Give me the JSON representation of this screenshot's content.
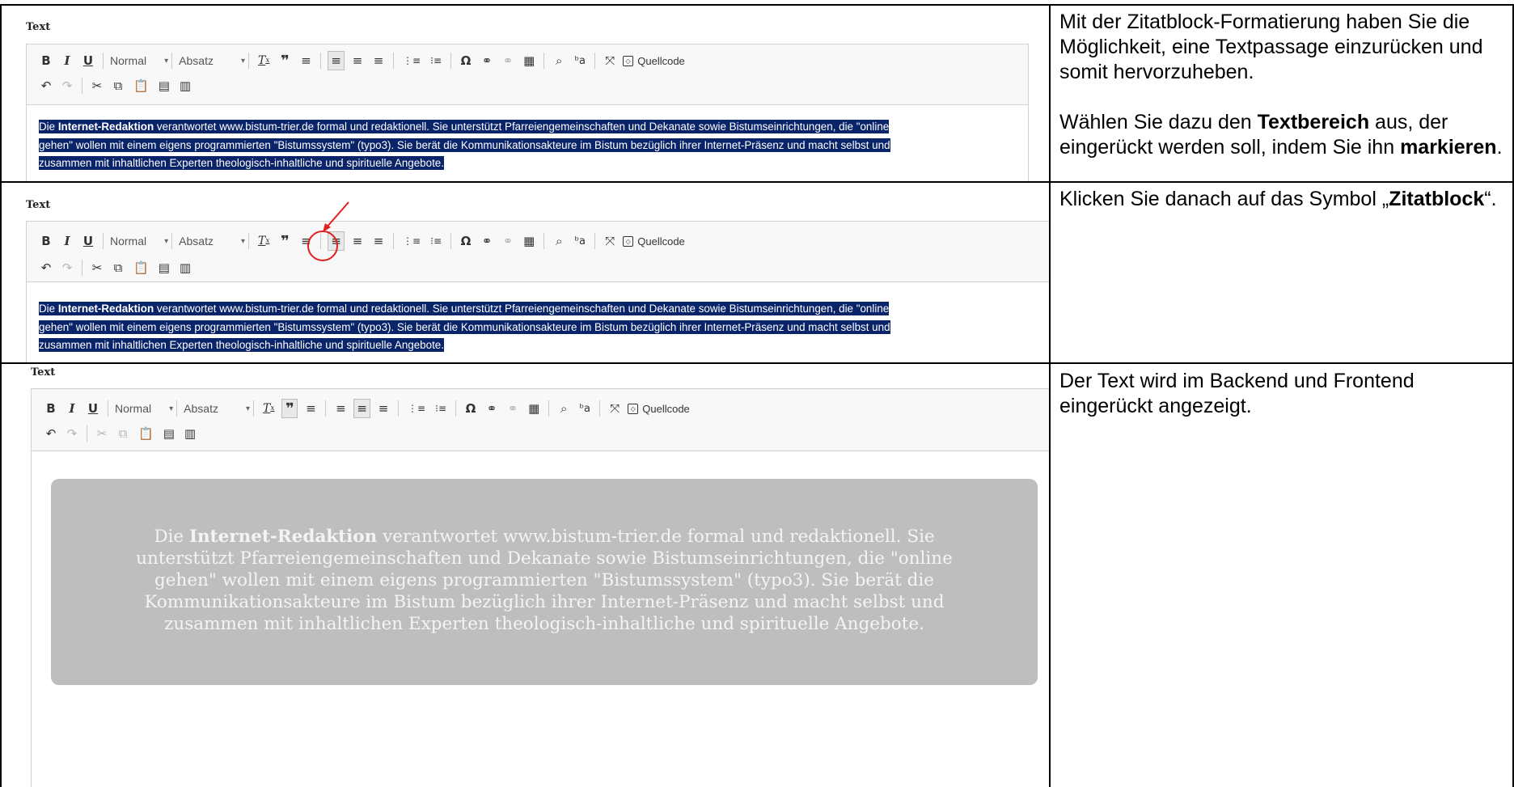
{
  "editor": {
    "label": "Text",
    "toolbar": {
      "bold": "B",
      "italic": "I",
      "underline": "U",
      "style_select": "Normal",
      "format_select": "Absatz",
      "dropdown_arrow": "▾",
      "remove_format": "Tx",
      "blockquote": "❞",
      "source_label": "Quellcode",
      "icons": [
        "bold-icon",
        "italic-icon",
        "underline-icon",
        "remove-format-icon",
        "blockquote-icon",
        "horizontal-rule-icon",
        "align-left-icon",
        "align-center-icon",
        "align-right-icon",
        "numbered-list-icon",
        "bulleted-list-icon",
        "special-char-icon",
        "link-icon",
        "unlink-icon",
        "table-icon",
        "find-icon",
        "replace-icon",
        "maximize-icon",
        "source-icon",
        "undo-icon",
        "redo-icon",
        "cut-icon",
        "copy-icon",
        "paste-icon",
        "paste-text-icon",
        "paste-word-icon"
      ]
    },
    "content_pre": "Die ",
    "content_bold": "Internet-Redaktion",
    "content_line1": " verantwortet www.bistum-trier.de formal und redaktionell. Sie unterstützt Pfarreiengemeinschaften und Dekanate sowie Bistumseinrichtungen, die \"online",
    "content_line2": "gehen\" wollen mit einem eigens programmierten \"Bistumssystem\" (typo3). Sie berät die Kommunikationsakteure im Bistum bezüglich ihrer Internet-Präsenz und macht selbst und",
    "content_line3": "zusammen mit inhaltlichen Experten theologisch-inhaltliche und spirituelle Angebote.",
    "quote_line1_rest": " verantwortet www.bistum-trier.de formal und redaktionell. Sie",
    "quote_line2": "unterstützt Pfarreiengemeinschaften und Dekanate sowie Bistumseinrichtungen, die \"online",
    "quote_line3": "gehen\" wollen mit einem eigens programmierten \"Bistumssystem\" (typo3). Sie berät die",
    "quote_line4": "Kommunikationsakteure im Bistum bezüglich ihrer Internet-Präsenz und macht selbst und",
    "quote_line5": "zusammen mit inhaltlichen Experten theologisch-inhaltliche und spirituelle Angebote."
  },
  "instructions": {
    "row1_p1": "Mit der Zitatblock-Formatierung haben Sie die Möglichkeit, eine Textpassage einzurücken und somit hervorzuheben.",
    "row1_p2_a": "Wählen Sie dazu den ",
    "row1_p2_b": "Textbereich",
    "row1_p2_c": " aus, der eingerückt werden soll, indem Sie ihn ",
    "row1_p2_d": "markieren",
    "row1_p2_e": ".",
    "row2_a": "Klicken Sie danach auf das Symbol „",
    "row2_b": "Zitatblock",
    "row2_c": "“.",
    "row3": "Der Text wird im Backend und Frontend eingerückt angezeigt."
  },
  "colors": {
    "selection": "#0a246a",
    "annotation": "#e02020",
    "quote_bg": "#bebebe"
  }
}
